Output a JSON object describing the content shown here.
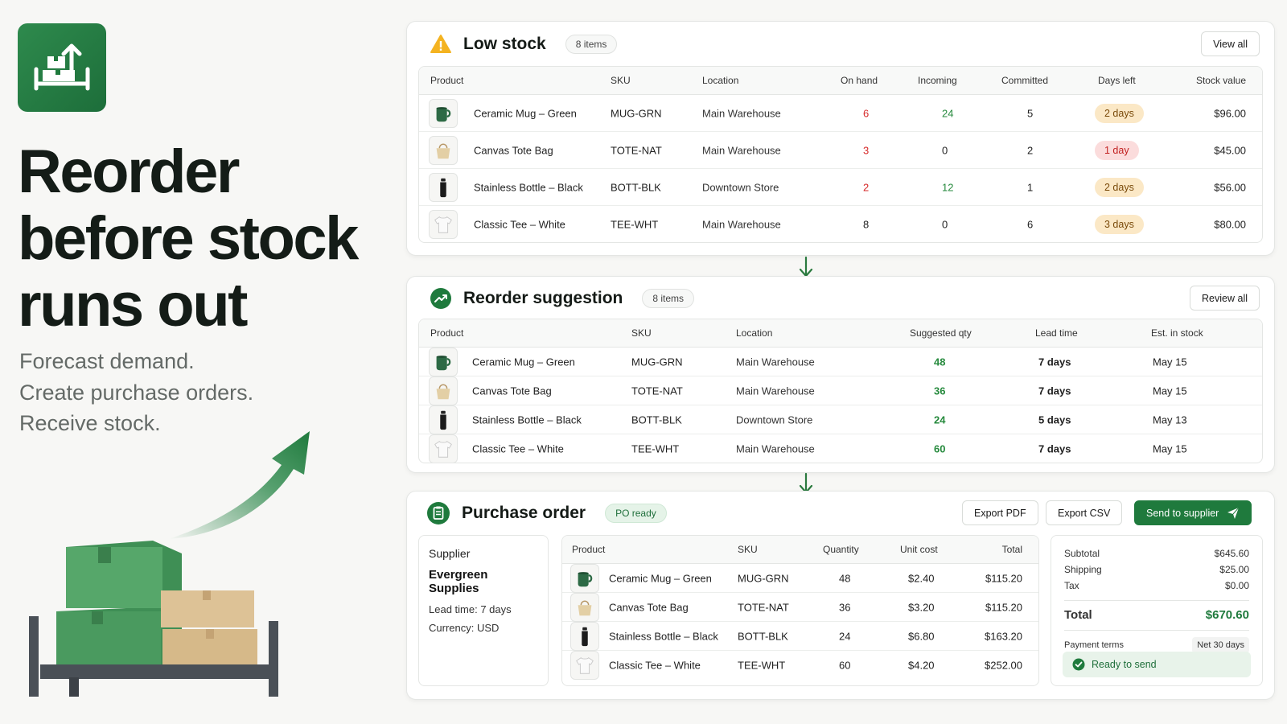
{
  "hero": {
    "title": "Reorder\nbefore stock\nruns out",
    "subtitle": [
      "Forecast demand.",
      "Create purchase orders.",
      "Receive stock."
    ]
  },
  "colors": {
    "brand": "#1f7a3d",
    "danger": "#d62a2a",
    "positive": "#268a3d",
    "warning_bg": "#fbe8c6"
  },
  "low_stock": {
    "title": "Low stock",
    "badge": "8 items",
    "action": "View all",
    "icon": "warning-icon",
    "columns": [
      "Product",
      "SKU",
      "Location",
      "On hand",
      "Incoming",
      "Committed",
      "Days left",
      "Stock value"
    ],
    "rows": [
      {
        "product": "Ceramic Mug – Green",
        "thumb": "mug",
        "sku": "MUG-GRN",
        "location": "Main Warehouse",
        "on_hand": "6",
        "incoming": "24",
        "committed": "5",
        "days_left": "2 days",
        "severity": "warning",
        "value": "$96.00"
      },
      {
        "product": "Canvas Tote Bag",
        "thumb": "tote",
        "sku": "TOTE-NAT",
        "location": "Main Warehouse",
        "on_hand": "3",
        "incoming": "0",
        "committed": "2",
        "days_left": "1 day",
        "severity": "critical",
        "value": "$45.00"
      },
      {
        "product": "Stainless Bottle – Black",
        "thumb": "bottle",
        "sku": "BOTT-BLK",
        "location": "Downtown Store",
        "on_hand": "2",
        "incoming": "12",
        "committed": "1",
        "days_left": "2 days",
        "severity": "warning",
        "value": "$56.00"
      },
      {
        "product": "Classic Tee – White",
        "thumb": "tee",
        "sku": "TEE-WHT",
        "location": "Main Warehouse",
        "on_hand": "8",
        "incoming": "0",
        "committed": "6",
        "days_left": "3 days",
        "severity": "warning",
        "value": "$80.00"
      }
    ]
  },
  "reorder": {
    "title": "Reorder suggestion",
    "badge": "8 items",
    "action": "Review all",
    "icon": "trend-up-icon",
    "columns": [
      "Product",
      "SKU",
      "Location",
      "Suggested qty",
      "Lead time",
      "Est. in stock"
    ],
    "rows": [
      {
        "product": "Ceramic Mug – Green",
        "thumb": "mug",
        "sku": "MUG-GRN",
        "location": "Main Warehouse",
        "qty": "48",
        "lead": "7 days",
        "est": "May 15"
      },
      {
        "product": "Canvas Tote Bag",
        "thumb": "tote",
        "sku": "TOTE-NAT",
        "location": "Main Warehouse",
        "qty": "36",
        "lead": "7 days",
        "est": "May 15"
      },
      {
        "product": "Stainless Bottle – Black",
        "thumb": "bottle",
        "sku": "BOTT-BLK",
        "location": "Downtown Store",
        "qty": "24",
        "lead": "5 days",
        "est": "May 13"
      },
      {
        "product": "Classic Tee – White",
        "thumb": "tee",
        "sku": "TEE-WHT",
        "location": "Main Warehouse",
        "qty": "60",
        "lead": "7 days",
        "est": "May 15"
      }
    ]
  },
  "po": {
    "title": "Purchase order",
    "badge": "PO ready",
    "icon": "clipboard-icon",
    "export_pdf": "Export PDF",
    "export_csv": "Export CSV",
    "send": "Send to supplier",
    "supplier": {
      "label": "Supplier",
      "name": "Evergreen Supplies",
      "lead": "Lead time: 7 days",
      "currency": "Currency: USD"
    },
    "columns": [
      "Product",
      "SKU",
      "Quantity",
      "Unit cost",
      "Total"
    ],
    "rows": [
      {
        "product": "Ceramic Mug – Green",
        "thumb": "mug",
        "sku": "MUG-GRN",
        "qty": "48",
        "unit": "$2.40",
        "total": "$115.20"
      },
      {
        "product": "Canvas Tote Bag",
        "thumb": "tote",
        "sku": "TOTE-NAT",
        "qty": "36",
        "unit": "$3.20",
        "total": "$115.20"
      },
      {
        "product": "Stainless Bottle – Black",
        "thumb": "bottle",
        "sku": "BOTT-BLK",
        "qty": "24",
        "unit": "$6.80",
        "total": "$163.20"
      },
      {
        "product": "Classic Tee – White",
        "thumb": "tee",
        "sku": "TEE-WHT",
        "qty": "60",
        "unit": "$4.20",
        "total": "$252.00"
      }
    ],
    "summary": {
      "subtotal_label": "Subtotal",
      "subtotal": "$645.60",
      "shipping_label": "Shipping",
      "shipping": "$25.00",
      "tax_label": "Tax",
      "tax": "$0.00",
      "total_label": "Total",
      "total": "$670.60",
      "terms_label": "Payment terms",
      "terms": "Net 30 days",
      "status": "Ready to send"
    }
  }
}
